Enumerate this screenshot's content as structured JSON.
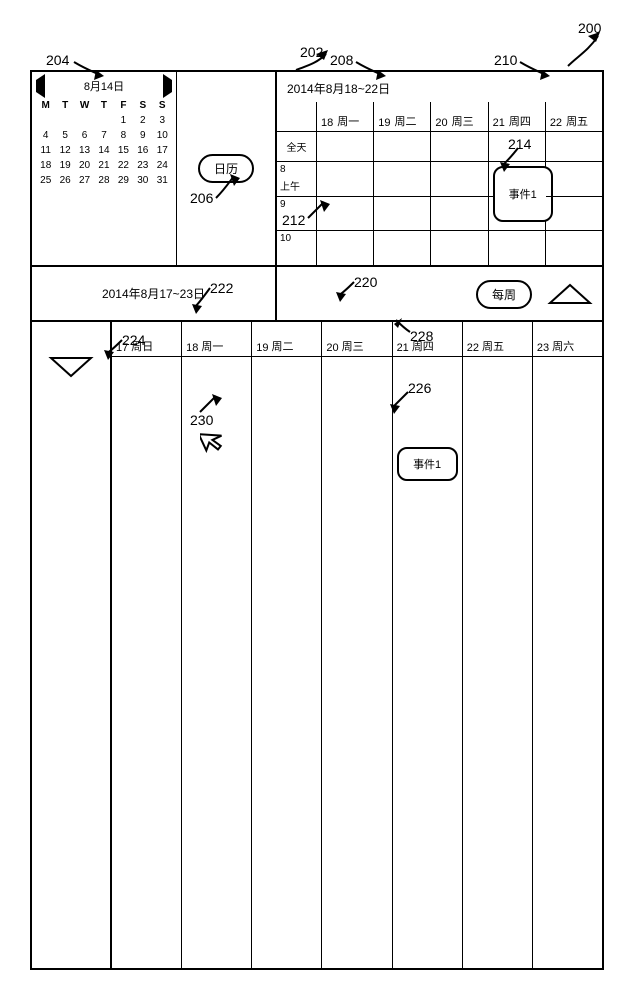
{
  "refs": {
    "r200": "200",
    "r202": "202",
    "r204": "204",
    "r206": "206",
    "r208": "208",
    "r210": "210",
    "r212": "212",
    "r214": "214",
    "r220": "220",
    "r222": "222",
    "r224": "224",
    "r226": "226",
    "r228": "228",
    "r230": "230"
  },
  "miniCal": {
    "title": "8月14日",
    "dow": [
      "M",
      "T",
      "W",
      "T",
      "F",
      "S",
      "S"
    ],
    "rows": [
      [
        "",
        "",
        "",
        "",
        "1",
        "2",
        "3"
      ],
      [
        "4",
        "5",
        "6",
        "7",
        "8",
        "9",
        "10"
      ],
      [
        "11",
        "12",
        "13",
        "14",
        "15",
        "16",
        "17"
      ],
      [
        "18",
        "19",
        "20",
        "21",
        "22",
        "23",
        "24"
      ],
      [
        "25",
        "26",
        "27",
        "28",
        "29",
        "30",
        "31"
      ]
    ]
  },
  "calButton": "日历",
  "workWeek": {
    "title": "2014年8月18~22日",
    "days": [
      {
        "num": "18",
        "name": "周一"
      },
      {
        "num": "19",
        "name": "周二"
      },
      {
        "num": "20",
        "name": "周三"
      },
      {
        "num": "21",
        "name": "周四"
      },
      {
        "num": "22",
        "name": "周五"
      }
    ],
    "allDayLabel": "全天",
    "hours": [
      "8",
      "9",
      "10"
    ],
    "ampm": "上午",
    "event1": "事件1"
  },
  "midTitle": "2014年8月17~23日",
  "weeklyLabel": "每周",
  "week": {
    "days": [
      {
        "num": "17",
        "name": "周日"
      },
      {
        "num": "18",
        "name": "周一"
      },
      {
        "num": "19",
        "name": "周二"
      },
      {
        "num": "20",
        "name": "周三"
      },
      {
        "num": "21",
        "name": "周四"
      },
      {
        "num": "22",
        "name": "周五"
      },
      {
        "num": "23",
        "name": "周六"
      }
    ],
    "event1": "事件1"
  }
}
